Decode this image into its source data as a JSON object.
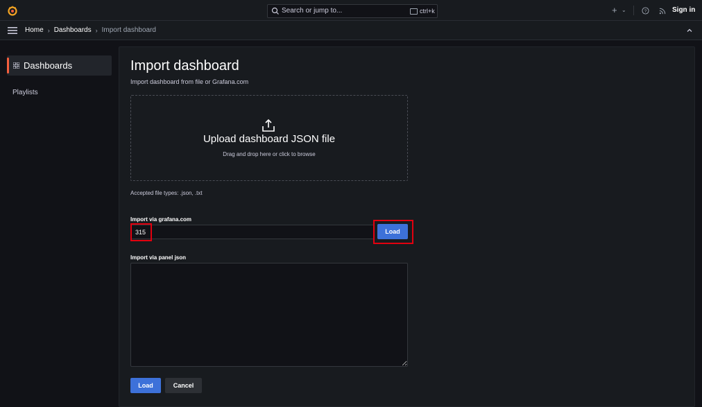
{
  "topbar": {
    "logo_icon": "grafana-logo-icon",
    "search_placeholder": "Search or jump to...",
    "search_shortcut": "ctrl+k",
    "new_icon": "plus-icon",
    "help_icon": "help-icon",
    "news_icon": "rss-icon",
    "sign_in": "Sign in"
  },
  "breadcrumb": {
    "items": [
      "Home",
      "Dashboards"
    ],
    "current": "Import dashboard"
  },
  "sidebar": {
    "active_section": "Dashboards",
    "items": [
      "Playlists"
    ]
  },
  "page": {
    "title": "Import dashboard",
    "subtitle": "Import dashboard from file or Grafana.com",
    "upload_title": "Upload dashboard JSON file",
    "upload_hint": "Drag and drop here or click to browse",
    "accepted_types": "Accepted file types: .json, .txt",
    "grafana_com_label": "Import via grafana.com",
    "grafana_com_value": "315",
    "grafana_com_load": "Load",
    "panel_json_label": "Import via panel json",
    "panel_json_value": "",
    "load_button": "Load",
    "cancel_button": "Cancel"
  },
  "colors": {
    "accent_blue": "#3d71d9",
    "brand_orange": "#f55f3e",
    "highlight_red": "#e3000f"
  }
}
